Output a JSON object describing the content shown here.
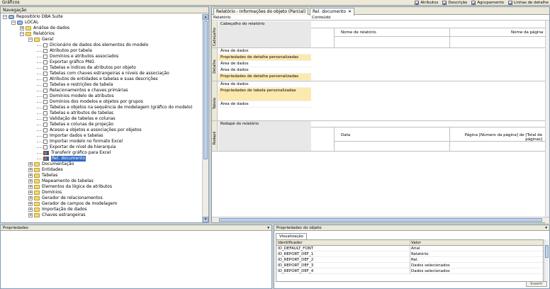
{
  "topbar": {
    "label": "Gráficos",
    "checks": [
      {
        "label": "Atributos",
        "checked": true
      },
      {
        "label": "Descrição",
        "checked": true
      },
      {
        "label": "Agrupamento",
        "checked": true
      },
      {
        "label": "Linhas de detalhe",
        "checked": true
      }
    ]
  },
  "nav": {
    "header": "Navegação",
    "tree": [
      {
        "label": "Repositório DBA Suite",
        "icon": "db",
        "depth": 0,
        "exp": "-"
      },
      {
        "label": "LOCAL",
        "icon": "db",
        "depth": 1,
        "exp": "-"
      },
      {
        "label": "Análise de dados",
        "icon": "folder",
        "depth": 2,
        "exp": "+"
      },
      {
        "label": "Relatórios",
        "icon": "folder",
        "depth": 2,
        "exp": "-"
      },
      {
        "label": "Geral",
        "icon": "folder",
        "depth": 3,
        "exp": "-"
      },
      {
        "label": "Dicionário de dados dos elementos do modelo",
        "icon": "doc",
        "depth": 4
      },
      {
        "label": "Atributos por tabela",
        "icon": "doc",
        "depth": 4
      },
      {
        "label": "Domínios e atributos associados",
        "icon": "doc",
        "depth": 4
      },
      {
        "label": "Exportar gráfico PNG",
        "icon": "doc",
        "depth": 4
      },
      {
        "label": "Tabelas e índices de atributos por objeto",
        "icon": "doc",
        "depth": 4
      },
      {
        "label": "Tabelas com chaves estrangeiras e níveis de associação",
        "icon": "doc",
        "depth": 4
      },
      {
        "label": "Atributos de entidades e tabelas e suas descrições",
        "icon": "doc",
        "depth": 4
      },
      {
        "label": "Tabelas e restrições de tabela",
        "icon": "doc",
        "depth": 4
      },
      {
        "label": "Relacionamentos e chaves primárias",
        "icon": "doc",
        "depth": 4
      },
      {
        "label": "Domínios modelo de atributos",
        "icon": "doc",
        "depth": 4
      },
      {
        "label": "Domínios dos modelos e objetos por grupos",
        "icon": "doc",
        "depth": 4
      },
      {
        "label": "Tabelas e objetos na sequência de modelagem (gráfico do modelo)",
        "icon": "doc",
        "depth": 4
      },
      {
        "label": "Tabelas e atributos de tabelas",
        "icon": "doc",
        "depth": 4
      },
      {
        "label": "Validação de tabelas e colunas",
        "icon": "doc",
        "depth": 4
      },
      {
        "label": "Tabelas e colunas de projeção",
        "icon": "doc",
        "depth": 4
      },
      {
        "label": "Acesso a objetos e associações por objetos",
        "icon": "doc",
        "depth": 4
      },
      {
        "label": "Importar dados e tabelas",
        "icon": "doc",
        "depth": 4
      },
      {
        "label": "Importar modelo no formato Excel",
        "icon": "doc",
        "depth": 4
      },
      {
        "label": "Exportar de nível de hierarquia",
        "icon": "doc",
        "depth": 4
      },
      {
        "label": "Transferir gráfico para Excel",
        "icon": "chart",
        "depth": 4
      },
      {
        "label": "Rel. documento",
        "icon": "chart",
        "depth": 4,
        "selected": true
      },
      {
        "label": "Documentação",
        "icon": "folder",
        "depth": 3,
        "exp": "+"
      },
      {
        "label": "Entidades",
        "icon": "folder",
        "depth": 3,
        "exp": "+"
      },
      {
        "label": "Tabelas",
        "icon": "folder",
        "depth": 3,
        "exp": "+"
      },
      {
        "label": "Mapeamento de tabelas",
        "icon": "folder",
        "depth": 3,
        "exp": "+"
      },
      {
        "label": "Elementos da lógica de atributos",
        "icon": "folder",
        "depth": 3,
        "exp": "+"
      },
      {
        "label": "Domínios",
        "icon": "folder",
        "depth": 3,
        "exp": "+"
      },
      {
        "label": "Gerador de relacionamentos",
        "icon": "folder",
        "depth": 3,
        "exp": "+"
      },
      {
        "label": "Gerador de campos de modelagem",
        "icon": "folder",
        "depth": 3,
        "exp": "+"
      },
      {
        "label": "Importação de dados",
        "icon": "folder",
        "depth": 3,
        "exp": "+"
      },
      {
        "label": "Chaves estrangeiras",
        "icon": "folder",
        "depth": 3,
        "exp": "+"
      }
    ]
  },
  "editor": {
    "tabs": [
      {
        "label": "Relatório - Informações do objeto (Parcial)",
        "active": false
      },
      {
        "label": "Rel. documento",
        "active": true
      }
    ],
    "subheader": {
      "left": "Relatório",
      "right": "Conteúdo"
    },
    "bands": [
      {
        "label": "Cabeçalho"
      },
      {
        "label": "Detalhe"
      },
      {
        "label": "Tabela"
      },
      {
        "label": "Rodapé"
      }
    ],
    "header_area": "Cabeçalho do relatório",
    "header_cols": [
      "Nome de relatório",
      "Nome da página"
    ],
    "fields": [
      {
        "label": "Área de dados",
        "style": "w"
      },
      {
        "label": "Propriedades de detalhe personalizadas",
        "style": "y"
      },
      {
        "label": "Área de dados",
        "style": "w"
      },
      {
        "label": "Área de dados",
        "style": "w"
      },
      {
        "label": "Propriedades de detalhe personalizadas",
        "style": "y"
      },
      {
        "label": "Área de dados",
        "style": "w"
      },
      {
        "label": "Propriedades de tabela personalizadas",
        "style": "y"
      },
      {
        "label": "Área de dados",
        "style": "w"
      }
    ],
    "footer_area": "Rodapé do relatório",
    "footer_cols": [
      "Data",
      "Página [Número da página] de [Total de páginas]"
    ]
  },
  "bottom_left": {
    "header": "Propriedades"
  },
  "properties": {
    "header": "Propriedades do objeto",
    "tab": "Visualização",
    "columns": [
      "Identificador",
      "Valor"
    ],
    "rows": [
      {
        "key": "ID_DEFAULT_FONT",
        "value": "Arial"
      },
      {
        "key": "ID_REPORT_DEF_1",
        "value": "Relatório"
      },
      {
        "key": "ID_REPORT_DEF_2",
        "value": "Rel."
      },
      {
        "key": "ID_REPORT_DEF_3",
        "value": "Dados selecionados"
      },
      {
        "key": "ID_REPORT_DEF_4",
        "value": "Dados selecionados"
      }
    ],
    "button": "Inserir"
  }
}
